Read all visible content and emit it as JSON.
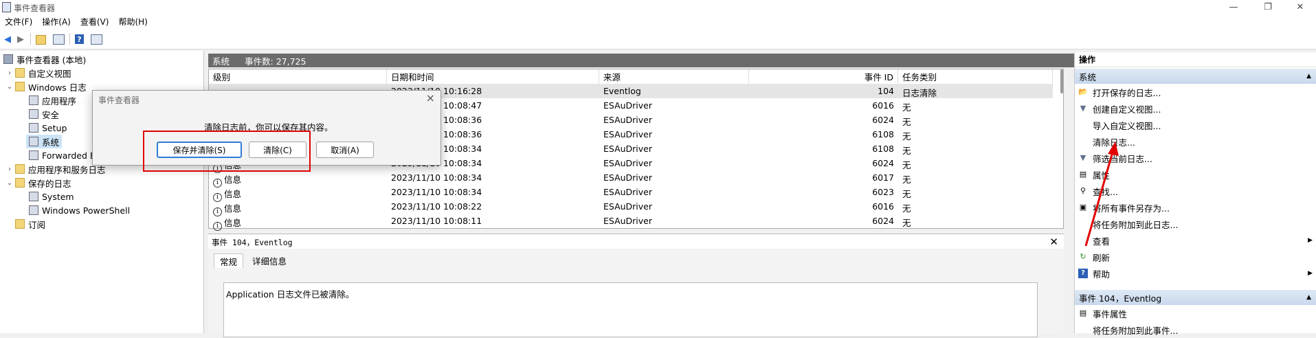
{
  "window": {
    "title": "事件查看器",
    "controls": [
      "—",
      "❐",
      "✕"
    ]
  },
  "menu": [
    "文件(F)",
    "操作(A)",
    "查看(V)",
    "帮助(H)"
  ],
  "toolbar": [
    "back-arrow-icon",
    "forward-arrow-icon",
    "folder-up-icon",
    "show-hide-tree-icon",
    "help-icon",
    "properties-panel-icon"
  ],
  "tree": {
    "root": "事件查看器 (本地)",
    "custom_views": "自定义视图",
    "windows_logs": "Windows 日志",
    "windows_children": [
      "应用程序",
      "安全",
      "Setup",
      "系统",
      "Forwarded Events"
    ],
    "apps_services": "应用程序和服务日志",
    "saved_logs": "保存的日志",
    "saved_children": [
      "System",
      "Windows PowerShell"
    ],
    "subscriptions": "订阅"
  },
  "center": {
    "title": "系统",
    "count_label": "事件数: 27,725"
  },
  "grid": {
    "headers": [
      "级别",
      "日期和时间",
      "来源",
      "事件 ID",
      "任务类别"
    ],
    "rows": [
      {
        "level": "",
        "date": "2023/11/10 10:16:28",
        "source": "Eventlog",
        "id": "104",
        "cat": "日志清除"
      },
      {
        "level": "",
        "date": "2023/11/10 10:08:47",
        "source": "ESAuDriver",
        "id": "6016",
        "cat": "无"
      },
      {
        "level": "",
        "date": "2023/11/10 10:08:36",
        "source": "ESAuDriver",
        "id": "6024",
        "cat": "无"
      },
      {
        "level": "",
        "date": "2023/11/10 10:08:36",
        "source": "ESAuDriver",
        "id": "6108",
        "cat": "无"
      },
      {
        "level": "",
        "date": "2023/11/10 10:08:34",
        "source": "ESAuDriver",
        "id": "6108",
        "cat": "无"
      },
      {
        "level": "信息",
        "date": "2023/11/10 10:08:34",
        "source": "ESAuDriver",
        "id": "6024",
        "cat": "无"
      },
      {
        "level": "信息",
        "date": "2023/11/10 10:08:34",
        "source": "ESAuDriver",
        "id": "6017",
        "cat": "无"
      },
      {
        "level": "信息",
        "date": "2023/11/10 10:08:34",
        "source": "ESAuDriver",
        "id": "6023",
        "cat": "无"
      },
      {
        "level": "信息",
        "date": "2023/11/10 10:08:22",
        "source": "ESAuDriver",
        "id": "6016",
        "cat": "无"
      },
      {
        "level": "信息",
        "date": "2023/11/10 10:08:11",
        "source": "ESAuDriver",
        "id": "6024",
        "cat": "无"
      }
    ]
  },
  "detail": {
    "title": "事件 104，Eventlog",
    "tabs": [
      "常规",
      "详细信息"
    ],
    "description": "Application 日志文件已被清除。"
  },
  "actions": {
    "title": "操作",
    "section1": "系统",
    "items1": [
      {
        "label": "打开保存的日志...",
        "icon": "open-log-icon"
      },
      {
        "label": "创建自定义视图...",
        "icon": "filter-icon"
      },
      {
        "label": "导入自定义视图...",
        "icon": "blank"
      },
      {
        "label": "清除日志...",
        "icon": "blank"
      },
      {
        "label": "筛选当前日志...",
        "icon": "filter-icon"
      },
      {
        "label": "属性",
        "icon": "properties-icon"
      },
      {
        "label": "查找...",
        "icon": "find-icon"
      },
      {
        "label": "将所有事件另存为...",
        "icon": "save-icon"
      },
      {
        "label": "将任务附加到此日志...",
        "icon": "blank"
      },
      {
        "label": "查看",
        "icon": "blank"
      },
      {
        "label": "刷新",
        "icon": "refresh-icon"
      },
      {
        "label": "帮助",
        "icon": "help-icon"
      }
    ],
    "section2": "事件 104，Eventlog",
    "items2": [
      {
        "label": "事件属性",
        "icon": "properties-icon"
      },
      {
        "label": "将任务附加到此事件...",
        "icon": "blank"
      }
    ]
  },
  "dialog": {
    "title": "事件查看器",
    "message": "清除日志前，你可以保存其内容。",
    "buttons": [
      "保存并清除(S)",
      "清除(C)",
      "取消(A)"
    ]
  },
  "colors": {
    "selection": "#cce4f7",
    "annotation_red": "#e10000",
    "header_gray": "#6b6b6b",
    "section_blue": "#d4e1f1"
  }
}
